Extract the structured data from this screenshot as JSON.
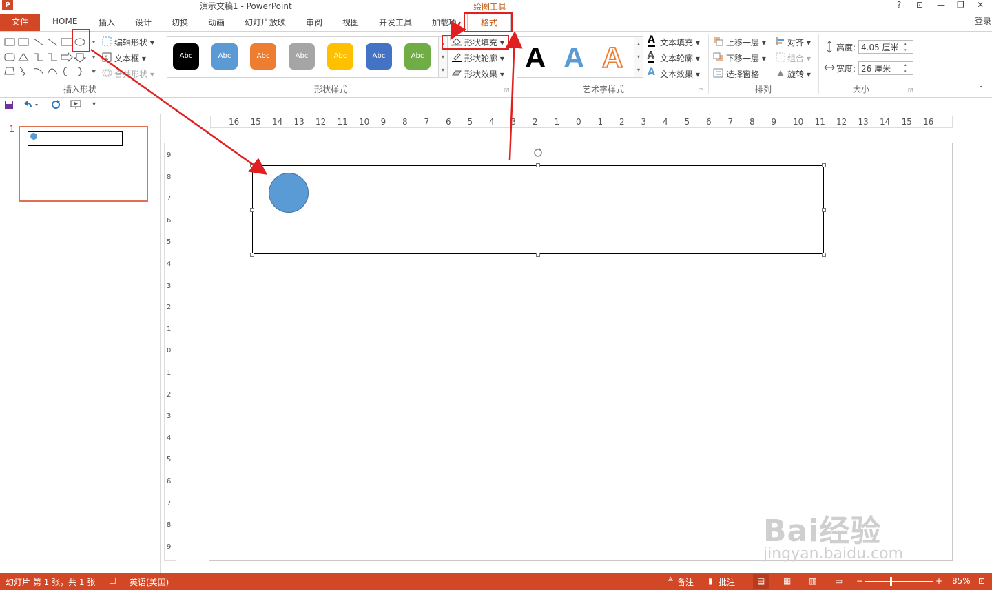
{
  "window": {
    "title": "演示文稿1 - PowerPoint",
    "context_tool": "绘图工具",
    "help": "?",
    "ribbon_opts": "⊡",
    "minimize": "—",
    "restore": "❐",
    "close": "✕",
    "login": "登录"
  },
  "tabs": {
    "file": "文件",
    "items": [
      "HOME",
      "插入",
      "设计",
      "切换",
      "动画",
      "幻灯片放映",
      "审阅",
      "视图",
      "开发工具",
      "加载项"
    ],
    "active": "格式"
  },
  "ribbon": {
    "insert_shapes": {
      "label": "插入形状",
      "edit_shape": "编辑形状 ▾",
      "text_box": "文本框 ▾",
      "merge_shapes": "合并形状 ▾"
    },
    "shape_styles": {
      "label": "形状样式",
      "swatch_text": "Abc",
      "fill": "形状填充 ▾",
      "outline": "形状轮廓 ▾",
      "effects": "形状效果 ▾"
    },
    "wordart": {
      "label": "艺术字样式",
      "sample": "A",
      "text_fill": "文本填充 ▾",
      "text_outline": "文本轮廓 ▾",
      "text_effects": "文本效果 ▾"
    },
    "arrange": {
      "label": "排列",
      "bring_forward": "上移一层 ▾",
      "send_backward": "下移一层 ▾",
      "selection_pane": "选择窗格",
      "align": "对齐 ▾",
      "group": "组合 ▾",
      "rotate": "旋转 ▾"
    },
    "size": {
      "label": "大小",
      "height_label": "高度:",
      "height_value": "4.05 厘米",
      "width_label": "宽度:",
      "width_value": "26 厘米"
    }
  },
  "swatch_colors": [
    "#000000",
    "#5b9bd5",
    "#ed7d31",
    "#a5a5a5",
    "#ffc000",
    "#4472c4",
    "#70ad47"
  ],
  "slides": {
    "current_number": "1"
  },
  "ruler": {
    "h_ticks": [
      "16",
      "15",
      "14",
      "13",
      "12",
      "11",
      "10",
      "9",
      "8",
      "7",
      "6",
      "5",
      "4",
      "3",
      "2",
      "1",
      "0",
      "1",
      "2",
      "3",
      "4",
      "5",
      "6",
      "7",
      "8",
      "9",
      "10",
      "11",
      "12",
      "13",
      "14",
      "15",
      "16"
    ],
    "v_ticks": [
      "9",
      "8",
      "7",
      "6",
      "5",
      "4",
      "3",
      "2",
      "1",
      "0",
      "1",
      "2",
      "3",
      "4",
      "5",
      "6",
      "7",
      "8",
      "9"
    ]
  },
  "status": {
    "slide_info": "幻灯片 第 1 张，共 1 张",
    "language": "英语(美国)",
    "notes": "备注",
    "comments": "批注",
    "zoom": "85%"
  },
  "watermark": {
    "logo": "Bai经验",
    "url": "jingyan.baidu.com"
  },
  "colors": {
    "accent": "#d24726",
    "context": "#c55a11",
    "shape_fill": "#5b9bd5",
    "annotation": "#e02020"
  }
}
